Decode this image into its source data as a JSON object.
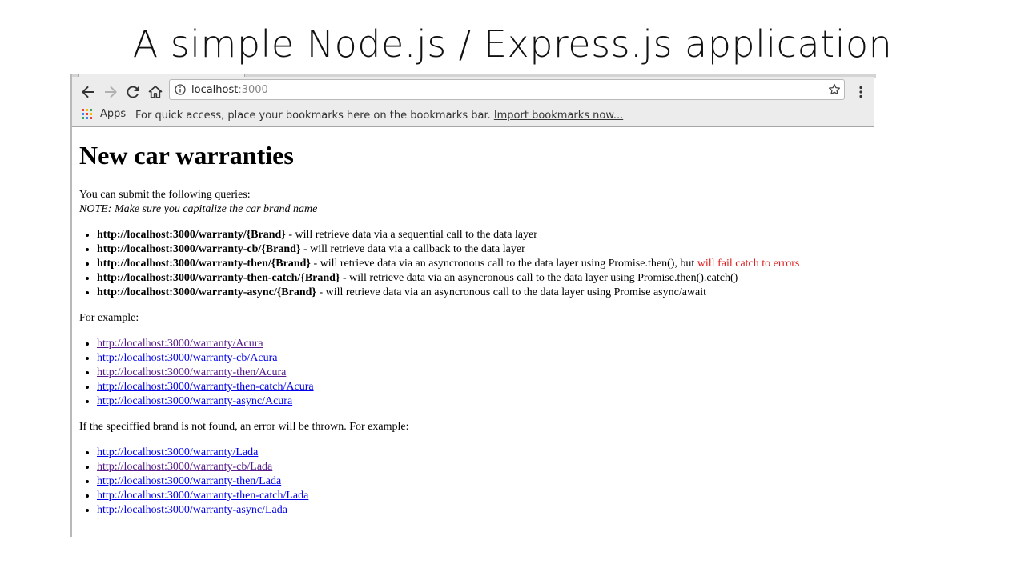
{
  "slide_title": "A simple Node.js / Express.js application",
  "browser": {
    "url_host": "localhost",
    "url_port": ":3000",
    "bookmarks": {
      "apps_label": "Apps",
      "hint": "For quick access, place your bookmarks here on the bookmarks bar.",
      "import_link": "Import bookmarks now..."
    }
  },
  "page": {
    "heading": "New car warranties",
    "intro": "You can submit the following queries:",
    "note": "NOTE: Make sure you capitalize the car brand name",
    "queries": [
      {
        "route": "http://localhost:3000/warranty/{Brand}",
        "desc": " - will retrieve data via a sequential call to the data layer",
        "extra": ""
      },
      {
        "route": "http://localhost:3000/warranty-cb/{Brand}",
        "desc": " - will retrieve data via a callback to the data layer",
        "extra": ""
      },
      {
        "route": "http://localhost:3000/warranty-then/{Brand}",
        "desc": " - will retrieve data via an asyncronous call to the data layer using Promise.then(), but ",
        "extra": "will fail catch to errors"
      },
      {
        "route": "http://localhost:3000/warranty-then-catch/{Brand}",
        "desc": " - will retrieve data via an asyncronous call to the data layer using Promise.then().catch()",
        "extra": ""
      },
      {
        "route": "http://localhost:3000/warranty-async/{Brand}",
        "desc": " - will retrieve data via an asyncronous call to the data layer using Promise async/await",
        "extra": ""
      }
    ],
    "example_intro": "For example:",
    "examples": [
      {
        "text": "http://localhost:3000/warranty/Acura",
        "visited": true
      },
      {
        "text": "http://localhost:3000/warranty-cb/Acura",
        "visited": false
      },
      {
        "text": "http://localhost:3000/warranty-then/Acura",
        "visited": true
      },
      {
        "text": "http://localhost:3000/warranty-then-catch/Acura",
        "visited": false
      },
      {
        "text": "http://localhost:3000/warranty-async/Acura",
        "visited": false
      }
    ],
    "error_intro": "If the speciffied brand is not found, an error will be thrown. For example:",
    "error_examples": [
      {
        "text": "http://localhost:3000/warranty/Lada",
        "visited": false
      },
      {
        "text": "http://localhost:3000/warranty-cb/Lada",
        "visited": true
      },
      {
        "text": "http://localhost:3000/warranty-then/Lada",
        "visited": false
      },
      {
        "text": "http://localhost:3000/warranty-then-catch/Lada",
        "visited": false
      },
      {
        "text": "http://localhost:3000/warranty-async/Lada",
        "visited": false
      }
    ]
  },
  "colors": {
    "link": "#0000ee",
    "visited": "#551a8b",
    "error": "#e01b1b",
    "chrome_bg": "#ececec"
  },
  "icons": [
    "back-arrow-icon",
    "forward-arrow-icon",
    "reload-icon",
    "home-icon",
    "info-icon",
    "star-icon",
    "menu-dots-icon",
    "apps-grid-icon"
  ]
}
